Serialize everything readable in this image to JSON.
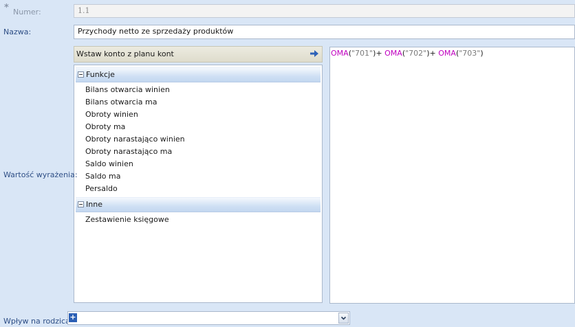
{
  "form": {
    "required_mark": "*",
    "numer": {
      "label": "Numer:",
      "value": "1.1"
    },
    "nazwa": {
      "label": "Nazwa:",
      "value": "Przychody netto ze sprzedaży produktów"
    },
    "wartosc": {
      "label": "Wartość wyrażenia:"
    },
    "wplyw": {
      "label": "Wpływ na rodzica:",
      "value": "+"
    }
  },
  "insert_bar": {
    "label": "Wstaw konto z planu kont"
  },
  "tree": {
    "groups": [
      {
        "label": "Funkcje",
        "items": [
          "Bilans otwarcia winien",
          "Bilans otwarcia ma",
          "Obroty winien",
          "Obroty ma",
          "Obroty narastająco winien",
          "Obroty narastająco ma",
          "Saldo winien",
          "Saldo ma",
          "Persaldo"
        ]
      },
      {
        "label": "Inne",
        "items": [
          "Zestawienie księgowe"
        ]
      }
    ]
  },
  "formula": {
    "tokens": [
      {
        "type": "fn",
        "text": "OMA"
      },
      {
        "type": "op",
        "text": "("
      },
      {
        "type": "str",
        "text": "\"701\""
      },
      {
        "type": "op",
        "text": ")+ "
      },
      {
        "type": "fn",
        "text": "OMA"
      },
      {
        "type": "op",
        "text": "("
      },
      {
        "type": "str",
        "text": "\"702\""
      },
      {
        "type": "op",
        "text": ")+ "
      },
      {
        "type": "fn",
        "text": "OMA"
      },
      {
        "type": "op",
        "text": "("
      },
      {
        "type": "str",
        "text": "\"703\""
      },
      {
        "type": "op",
        "text": ")"
      }
    ]
  },
  "colors": {
    "background": "#d9e6f6",
    "label": "#2f4f86",
    "function_token": "#c000c0"
  }
}
